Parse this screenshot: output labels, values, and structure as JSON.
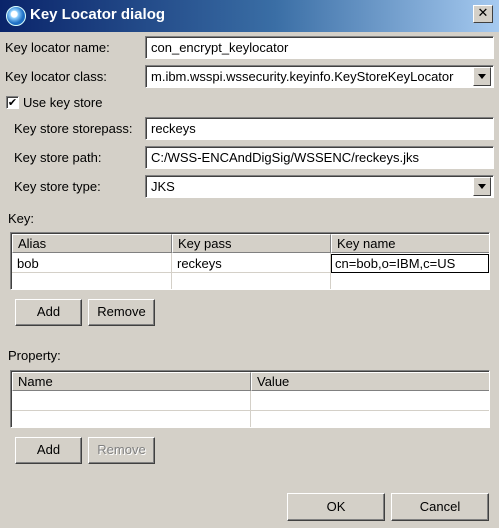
{
  "window": {
    "title": "Key Locator dialog",
    "close_symbol": "✕"
  },
  "form": {
    "name_label": "Key locator name:",
    "name_value": "con_encrypt_keylocator",
    "class_label": "Key locator class:",
    "class_value": "m.ibm.wsspi.wssecurity.keyinfo.KeyStoreKeyLocator",
    "use_keystore_label": "Use key store",
    "use_keystore_checked": true,
    "storepass_label": "Key store storepass:",
    "storepass_value": "reckeys",
    "path_label": "Key store path:",
    "path_value": "C:/WSS-ENCAndDigSig/WSSENC/reckeys.jks",
    "type_label": "Key store type:",
    "type_value": "JKS"
  },
  "key_section": {
    "label": "Key:",
    "columns": [
      "Alias",
      "Key pass",
      "Key name"
    ],
    "rows": [
      [
        "bob",
        "reckeys",
        "cn=bob,o=IBM,c=US"
      ]
    ],
    "add_label": "Add",
    "remove_label": "Remove"
  },
  "property_section": {
    "label": "Property:",
    "columns": [
      "Name",
      "Value"
    ],
    "add_label": "Add",
    "remove_label": "Remove"
  },
  "footer": {
    "ok_label": "OK",
    "cancel_label": "Cancel"
  }
}
